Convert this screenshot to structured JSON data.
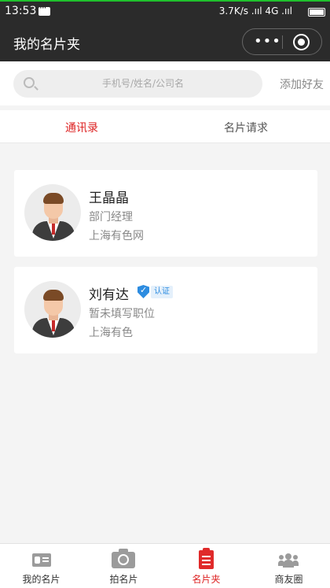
{
  "status_bar": {
    "time": "13:53",
    "network": "3.7K/s .ııl 4G .ııl"
  },
  "header": {
    "title": "我的名片夹",
    "more_label": "•••"
  },
  "search": {
    "placeholder": "手机号/姓名/公司名",
    "add_friend_label": "添加好友"
  },
  "tabs": [
    {
      "label": "通讯录",
      "active": true
    },
    {
      "label": "名片请求",
      "active": false
    }
  ],
  "contacts": [
    {
      "name": "王晶晶",
      "position": "部门经理",
      "company": "上海有色网",
      "verified": false
    },
    {
      "name": "刘有达",
      "position": "暂未填写职位",
      "company": "上海有色",
      "verified": true,
      "verified_label": "认证"
    }
  ],
  "bottom_nav": [
    {
      "label": "我的名片",
      "icon": "business-card-icon",
      "active": false
    },
    {
      "label": "拍名片",
      "icon": "camera-icon",
      "active": false
    },
    {
      "label": "名片夹",
      "icon": "card-folder-icon",
      "active": true,
      "color": "#e02a2a"
    },
    {
      "label": "商友圈",
      "icon": "group-icon",
      "active": false
    }
  ],
  "colors": {
    "accent": "#dd2222",
    "verified": "#2d8ce0",
    "header_bg": "#2b2b2b"
  }
}
